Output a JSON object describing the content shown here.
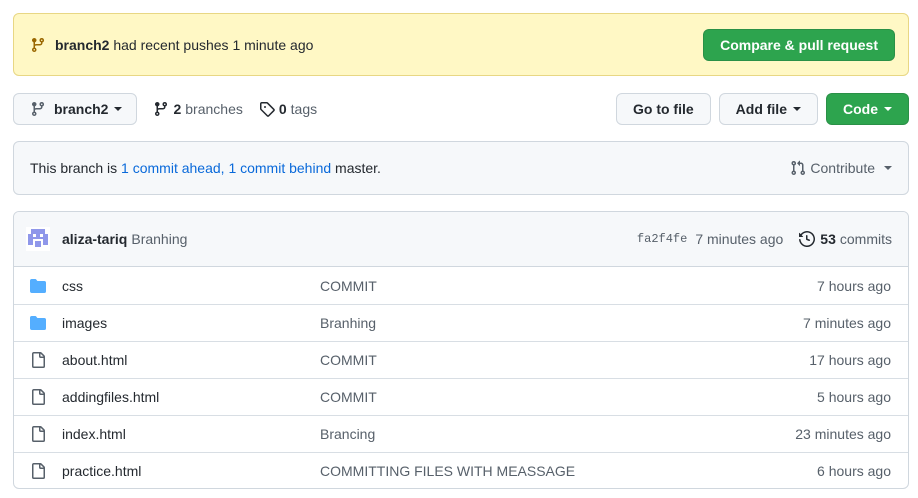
{
  "banner": {
    "branch": "branch2",
    "message": "had recent pushes 1 minute ago",
    "button": "Compare & pull request"
  },
  "toolbar": {
    "branch_select": "branch2",
    "branches_count": "2",
    "branches_label": "branches",
    "tags_count": "0",
    "tags_label": "tags",
    "go_to_file": "Go to file",
    "add_file": "Add file",
    "code": "Code"
  },
  "ahead_behind": {
    "prefix": "This branch is",
    "ahead": "1 commit ahead,",
    "behind": "1 commit behind",
    "suffix": "master.",
    "contribute": "Contribute"
  },
  "latest_commit": {
    "author": "aliza-tariq",
    "message": "Branhing",
    "sha": "fa2f4fe",
    "time": "7 minutes ago",
    "commits_count": "53",
    "commits_label": "commits"
  },
  "files": [
    {
      "type": "folder",
      "name": "css",
      "message": "COMMIT",
      "age": "7 hours ago"
    },
    {
      "type": "folder",
      "name": "images",
      "message": "Branhing",
      "age": "7 minutes ago"
    },
    {
      "type": "file",
      "name": "about.html",
      "message": "COMMIT",
      "age": "17 hours ago"
    },
    {
      "type": "file",
      "name": "addingfiles.html",
      "message": "COMMIT",
      "age": "5 hours ago"
    },
    {
      "type": "file",
      "name": "index.html",
      "message": "Brancing",
      "age": "23 minutes ago"
    },
    {
      "type": "file",
      "name": "practice.html",
      "message": "COMMITTING FILES WITH MEASSAGE",
      "age": "6 hours ago"
    }
  ],
  "colors": {
    "accent_green": "#2da44e",
    "link_blue": "#0969da",
    "folder_blue": "#54aeff",
    "banner_bg": "#fff8c5"
  }
}
